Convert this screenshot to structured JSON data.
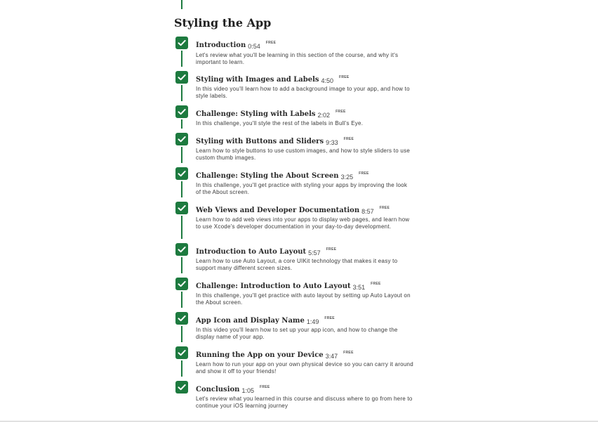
{
  "section": {
    "title": "Styling the App"
  },
  "icons": {
    "completed": "check-icon",
    "completed_color": "#1d7a3f"
  },
  "lessons": [
    {
      "title": "Introduction",
      "duration": "0:54",
      "badge": "FREE",
      "completed": true,
      "description": "Let's review what you'll be learning in this section of the course, and why it's important to learn."
    },
    {
      "title": "Styling with Images and Labels",
      "duration": "4:50",
      "badge": "FREE",
      "completed": true,
      "description": "In this video you'll learn how to add a background image to your app, and how to style labels."
    },
    {
      "title": "Challenge: Styling with Labels",
      "duration": "2:02",
      "badge": "FREE",
      "completed": true,
      "description": "In this challenge, you'll style the rest of the labels in Bull's Eye."
    },
    {
      "title": "Styling with Buttons and Sliders",
      "duration": "9:33",
      "badge": "FREE",
      "completed": true,
      "description": "Learn how to style buttons to use custom images, and how to style sliders to use custom thumb images."
    },
    {
      "title": "Challenge: Styling the About Screen",
      "duration": "3:25",
      "badge": "FREE",
      "completed": true,
      "description": "In this challenge, you'll get practice with styling your apps by improving the look of the About screen."
    },
    {
      "title": "Web Views and Developer Documentation",
      "duration": "8:57",
      "badge": "FREE",
      "completed": true,
      "description": "Learn how to add web views into your apps to display web pages, and learn how to use Xcode's developer documentation in your day-to-day development."
    },
    {
      "title": "Introduction to Auto Layout",
      "duration": "5:57",
      "badge": "FREE",
      "completed": true,
      "description": "Learn how to use Auto Layout, a core UIKit technology that makes it easy to support many different screen sizes."
    },
    {
      "title": "Challenge: Introduction to Auto Layout",
      "duration": "3:51",
      "badge": "FREE",
      "completed": true,
      "description": "In this challenge, you'll get practice with auto layout by setting up Auto Layout on the About screen."
    },
    {
      "title": "App Icon and Display Name",
      "duration": "1:49",
      "badge": "FREE",
      "completed": true,
      "description": "In this video you'll learn how to set up your app icon, and how to change the display name of your app."
    },
    {
      "title": "Running the App on your Device",
      "duration": "3:47",
      "badge": "FREE",
      "completed": true,
      "description": "Learn how to run your app on your own physical device so you can carry it around and show it off to your friends!"
    },
    {
      "title": "Conclusion",
      "duration": "1:05",
      "badge": "FREE",
      "completed": true,
      "description": "Let's review what you learned in this course and discuss where to go from here to continue your iOS learning journey"
    }
  ]
}
